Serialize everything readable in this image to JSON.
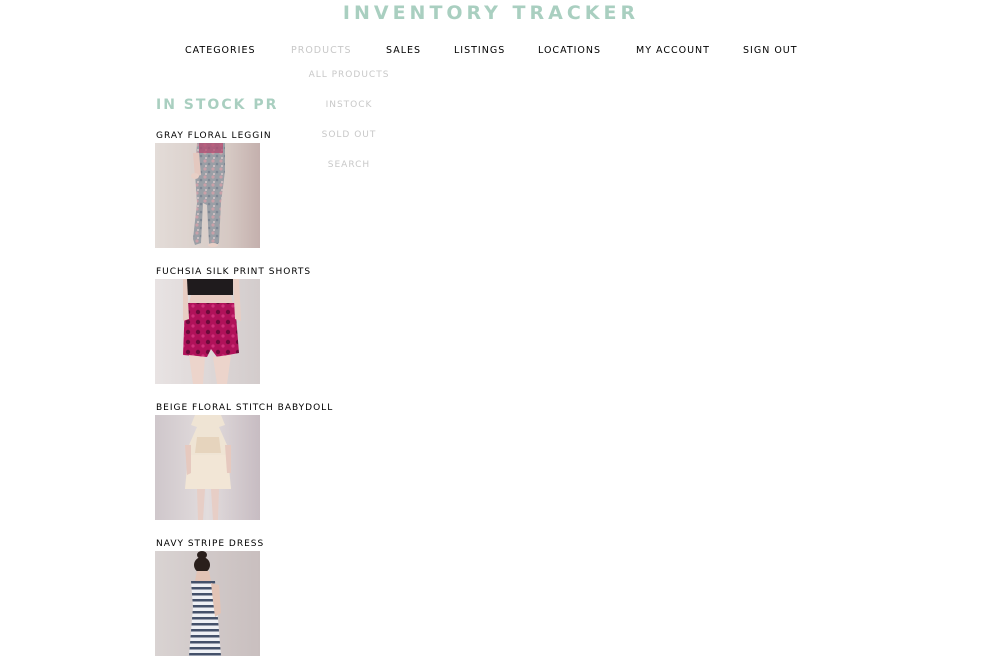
{
  "site": {
    "title": "INVENTORY TRACKER"
  },
  "nav": {
    "items": [
      {
        "label": "CATEGORIES"
      },
      {
        "label": "PRODUCTS"
      },
      {
        "label": "SALES"
      },
      {
        "label": "LISTINGS"
      },
      {
        "label": "LOCATIONS"
      },
      {
        "label": "MY ACCOUNT"
      },
      {
        "label": "SIGN OUT"
      }
    ],
    "active": "PRODUCTS"
  },
  "products_menu": {
    "items": [
      {
        "label": "ALL PRODUCTS"
      },
      {
        "label": "INSTOCK"
      },
      {
        "label": "SOLD OUT"
      },
      {
        "label": "SEARCH"
      }
    ]
  },
  "main": {
    "heading": "IN STOCK PR",
    "products": [
      {
        "name": "GRAY FLORAL LEGGIN"
      },
      {
        "name": "FUCHSIA SILK PRINT SHORTS"
      },
      {
        "name": "BEIGE FLORAL STITCH  BABYDOLL"
      },
      {
        "name": "NAVY STRIPE DRESS"
      }
    ]
  },
  "colors": {
    "accent": "#a9cfc0",
    "muted": "#c8c8c8",
    "text": "#000000"
  }
}
